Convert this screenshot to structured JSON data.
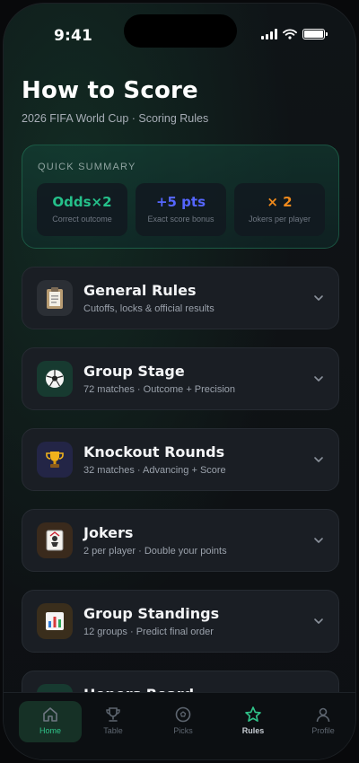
{
  "status_bar": {
    "time": "9:41"
  },
  "header": {
    "title": "How to Score",
    "subtitle": "2026 FIFA World Cup · Scoring Rules"
  },
  "summary": {
    "label": "QUICK SUMMARY",
    "stats": [
      {
        "value": "Odds×2",
        "label": "Correct outcome",
        "color": "#25c08a"
      },
      {
        "value": "+5 pts",
        "label": "Exact score bonus",
        "color": "#5566ff"
      },
      {
        "value": "× 2",
        "label": "Jokers per player",
        "color": "#f08a1c"
      }
    ]
  },
  "sections": [
    {
      "title": "General Rules",
      "subtitle": "Cutoffs, locks & official results",
      "icon": "clipboard-icon"
    },
    {
      "title": "Group Stage",
      "subtitle": "72 matches · Outcome + Precision",
      "icon": "soccer-ball-icon"
    },
    {
      "title": "Knockout Rounds",
      "subtitle": "32 matches · Advancing + Score",
      "icon": "trophy-icon"
    },
    {
      "title": "Jokers",
      "subtitle": "2 per player · Double your points",
      "icon": "joker-card-icon"
    },
    {
      "title": "Group Standings",
      "subtitle": "12 groups · Predict final order",
      "icon": "bar-chart-icon"
    },
    {
      "title": "Honors Board",
      "subtitle": "",
      "icon": "medal-icon"
    }
  ],
  "tabs": [
    {
      "label": "Home",
      "icon": "home-icon",
      "active": true
    },
    {
      "label": "Table",
      "icon": "trophy-icon",
      "active": false
    },
    {
      "label": "Picks",
      "icon": "ball-icon",
      "active": false
    },
    {
      "label": "Rules",
      "icon": "star-icon",
      "active": false
    },
    {
      "label": "Profile",
      "icon": "person-icon",
      "active": false
    }
  ]
}
